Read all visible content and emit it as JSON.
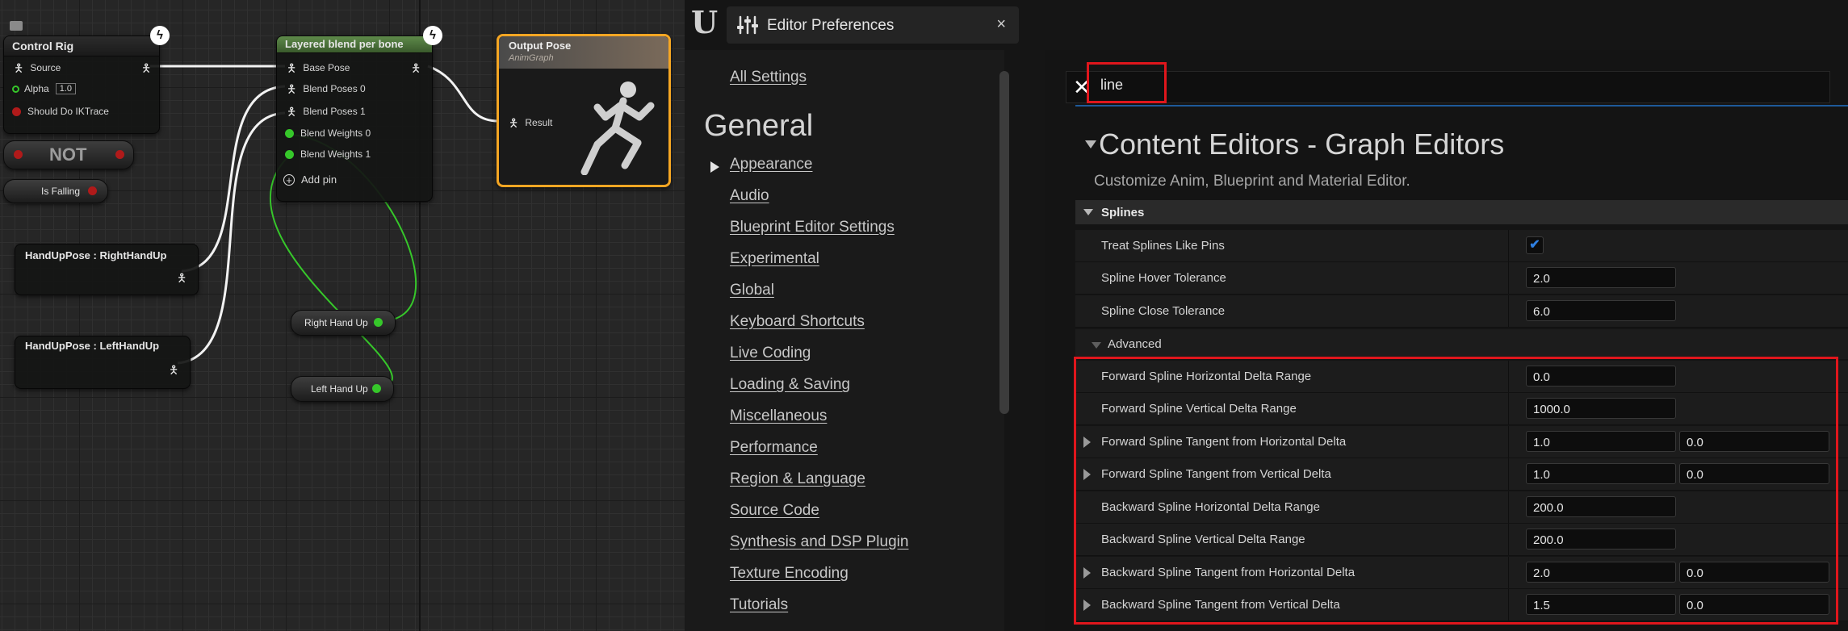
{
  "graph": {
    "control_rig": {
      "title": "Control Rig",
      "pins": [
        "Source",
        "Alpha",
        "Should Do IKTrace"
      ],
      "alpha_value": "1.0"
    },
    "not_node": "NOT",
    "is_falling": "Is Falling",
    "hand_right": "HandUpPose : RightHandUp",
    "hand_left": "HandUpPose : LeftHandUp",
    "layered_blend": {
      "title": "Layered blend per bone",
      "pins": [
        "Base Pose",
        "Blend Poses 0",
        "Blend Poses 1",
        "Blend Weights 0",
        "Blend Weights 1"
      ],
      "add_pin": "Add pin"
    },
    "output_pose": {
      "title": "Output Pose",
      "subtitle": "AnimGraph",
      "pin": "Result"
    },
    "right_hand_up": "Right Hand Up",
    "left_hand_up": "Left Hand Up"
  },
  "prefs": {
    "tab_title": "Editor Preferences",
    "tab_close": "×",
    "sidebar": {
      "all_settings": "All Settings",
      "heading": "General",
      "items": [
        "Appearance",
        "Audio",
        "Blueprint Editor Settings",
        "Experimental",
        "Global",
        "Keyboard Shortcuts",
        "Live Coding",
        "Loading & Saving",
        "Miscellaneous",
        "Performance",
        "Region & Language",
        "Source Code",
        "Synthesis and DSP Plugin",
        "Texture Encoding",
        "Tutorials"
      ]
    },
    "search": {
      "value": "line",
      "clear_glyph": "✕"
    },
    "category": {
      "title": "Content Editors - Graph Editors",
      "description": "Customize Anim, Blueprint and Material Editor."
    },
    "section": "Splines",
    "properties": [
      {
        "label": "Treat Splines Like Pins",
        "checked": true
      },
      {
        "label": "Spline Hover Tolerance",
        "value": "2.0"
      },
      {
        "label": "Spline Close Tolerance",
        "value": "6.0"
      }
    ],
    "advanced_label": "Advanced",
    "advanced": [
      {
        "label": "Forward Spline Horizontal Delta Range",
        "values": [
          "0.0"
        ]
      },
      {
        "label": "Forward Spline Vertical Delta Range",
        "values": [
          "1000.0"
        ]
      },
      {
        "label": "Forward Spline Tangent from Horizontal Delta",
        "values": [
          "1.0",
          "0.0"
        ],
        "expandable": true
      },
      {
        "label": "Forward Spline Tangent from Vertical Delta",
        "values": [
          "1.0",
          "0.0"
        ],
        "expandable": true
      },
      {
        "label": "Backward Spline Horizontal Delta Range",
        "values": [
          "200.0"
        ]
      },
      {
        "label": "Backward Spline Vertical Delta Range",
        "values": [
          "200.0"
        ]
      },
      {
        "label": "Backward Spline Tangent from Horizontal Delta",
        "values": [
          "2.0",
          "0.0"
        ],
        "expandable": true
      },
      {
        "label": "Backward Spline Tangent from Vertical Delta",
        "values": [
          "1.5",
          "0.0"
        ],
        "expandable": true
      }
    ],
    "colors": {
      "highlight": "#e0161c",
      "checkbox": "#2f7fe0",
      "bool_pin": "#b01a1a",
      "float_pin": "#36c72a"
    }
  }
}
